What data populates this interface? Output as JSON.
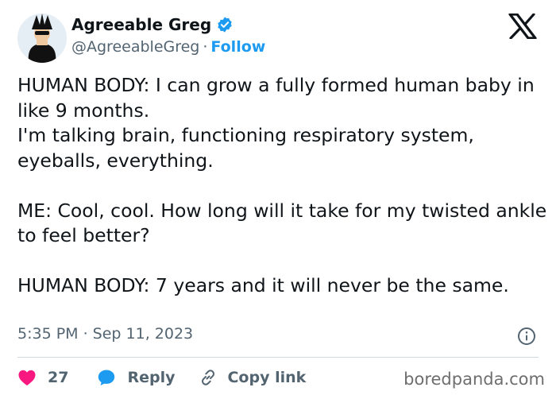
{
  "author": {
    "display_name": "Agreeable Greg",
    "handle": "@AgreeableGreg",
    "separator": "·",
    "follow_label": "Follow",
    "verified_color": "#1d9bf0"
  },
  "tweet": {
    "text": "HUMAN BODY: I can grow a fully formed human baby in like 9 months.\nI'm talking brain, functioning respiratory system, eyeballs, everything.\n\nME: Cool, cool. How long will it take for my twisted ankle to feel better?\n\nHUMAN BODY: 7 years and it will never be the same.",
    "timestamp": "5:35 PM · Sep 11, 2023"
  },
  "actions": {
    "like_count": "27",
    "reply_label": "Reply",
    "copy_link_label": "Copy link"
  },
  "icons": {
    "platform": "x-logo-icon",
    "info": "info-icon",
    "like": "heart-icon",
    "reply": "speech-bubble-icon",
    "copy": "link-icon"
  },
  "colors": {
    "text": "#0f1419",
    "muted": "#536471",
    "link": "#1d9bf0",
    "like": "#f91880",
    "divider": "#cfd9de"
  },
  "watermark": "boredpanda.com"
}
